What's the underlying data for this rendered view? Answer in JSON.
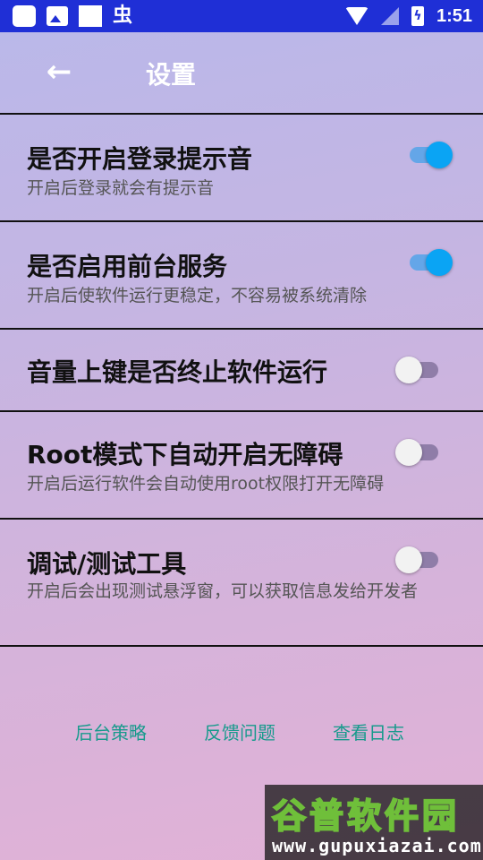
{
  "status_bar": {
    "time": "1:51",
    "bug_glyph": "虫",
    "icons": [
      "app-icon",
      "image-icon",
      "blank-icon",
      "bug-icon",
      "wifi-icon",
      "no-signal-icon",
      "battery-charging-icon"
    ]
  },
  "toolbar": {
    "back_icon": "←",
    "title": "设置"
  },
  "settings": [
    {
      "title": "是否开启登录提示音",
      "desc": "开启后登录就会有提示音",
      "enabled": true
    },
    {
      "title": "是否启用前台服务",
      "desc": "开启后使软件运行更稳定，不容易被系统清除",
      "enabled": true
    },
    {
      "title": "音量上键是否终止软件运行",
      "desc": "",
      "enabled": false
    },
    {
      "title": "Root模式下自动开启无障碍",
      "desc": "开启后运行软件会自动使用root权限打开无障碍",
      "enabled": false
    },
    {
      "title": "调试/测试工具",
      "desc": "开启后会出现测试悬浮窗，可以获取信息发给开发者",
      "enabled": false
    }
  ],
  "links": {
    "background_policy": "后台策略",
    "feedback": "反馈问题",
    "view_logs": "查看日志"
  },
  "watermark": {
    "top": "谷普软件园",
    "bottom": "www.gupuxiazai.com"
  },
  "colors": {
    "status_bar": "#1f2fd6",
    "switch_on_thumb": "#0aa4f4",
    "switch_on_track": "#64a6e8",
    "switch_off_thumb": "#f2f2f2",
    "switch_off_track": "#8f7da8",
    "link": "#179a8c"
  }
}
